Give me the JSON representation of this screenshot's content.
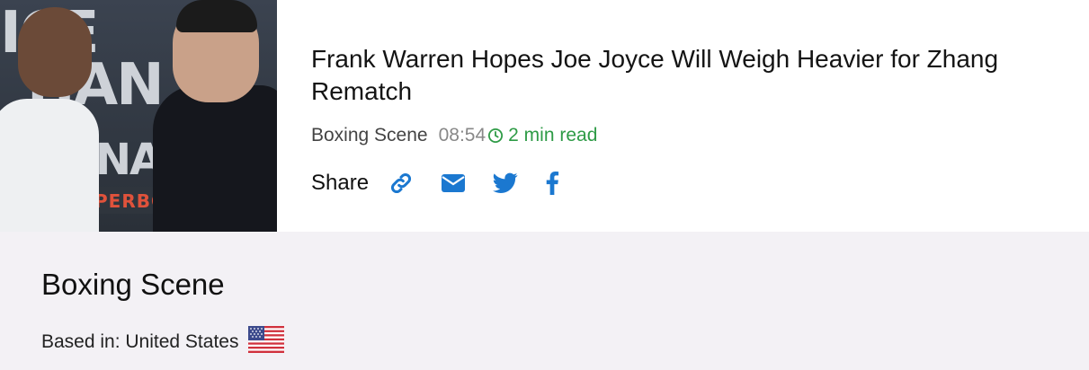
{
  "article": {
    "title": "Frank Warren Hopes Joe Joyce Will Weigh Heavier for Zhang Rematch",
    "source": "Boxing Scene",
    "time": "08:54",
    "read_time": "2 min read",
    "share_label": "Share",
    "image_backdrop_text": [
      "ICE",
      "HAN",
      "INAI",
      "PERBO"
    ]
  },
  "share_icons": [
    "link-icon",
    "email-icon",
    "twitter-icon",
    "facebook-icon"
  ],
  "publisher": {
    "name": "Boxing Scene",
    "based_in": "Based in: United States",
    "flag": "us-flag-icon"
  },
  "colors": {
    "accent_blue": "#1b78d0",
    "read_green": "#2e9b46",
    "footer_bg": "#f3f1f5"
  }
}
